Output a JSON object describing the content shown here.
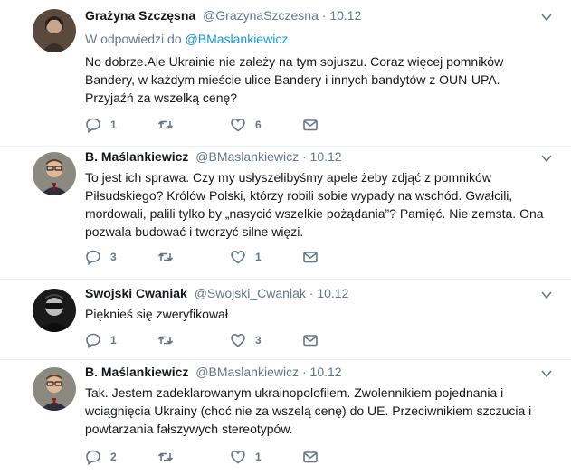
{
  "tweets": [
    {
      "name": "Grażyna Szczęsna",
      "handle": "@GrazynaSzczesna",
      "dot": "·",
      "time": "10.12",
      "reply_prefix": "W odpowiedzi do",
      "reply_mention": "@BMaslankiewicz",
      "text": "No dobrze.Ale Ukrainie nie zależy na tym sojuszu. Coraz więcej pomników Bandery, w każdym mieście ulice Bandery i innych bandytów z OUN-UPA. Przyjaźń za wszelką cenę?",
      "replies": "1",
      "retweets": "",
      "likes": "6"
    },
    {
      "name": "B. Maślankiewicz",
      "handle": "@BMaslankiewicz",
      "dot": "·",
      "time": "10.12",
      "text": "To jest ich sprawa. Czy my usłyszelibyśmy apele żeby zdjąć z pomników Piłsudskiego? Królów Polski, którzy robili sobie wypady na wschód. Gwałcili, mordowali, palili tylko by „nasycić wszelkie pożądania”? Pamięć. Nie zemsta. Ona pozwala budować i tworzyć silne więzi.",
      "replies": "3",
      "retweets": "",
      "likes": "1"
    },
    {
      "name": "Swojski Cwaniak",
      "handle": "@Swojski_Cwaniak",
      "dot": "·",
      "time": "10.12",
      "text": "Pięknieś się zweryfikował",
      "replies": "1",
      "retweets": "",
      "likes": "3"
    },
    {
      "name": "B. Maślankiewicz",
      "handle": "@BMaslankiewicz",
      "dot": "·",
      "time": "10.12",
      "text": "Tak. Jestem zadeklarowanym ukrainopolofilem. Zwolennikiem pojednania i wciągnięcia Ukrainy (choć nie za wszelą cenę) do UE. Przeciwnikiem szczucia i powtarzania fałszywych stereotypów.",
      "replies": "2",
      "retweets": "",
      "likes": "1"
    }
  ],
  "icons": {
    "reply": "reply-icon",
    "retweet": "retweet-icon",
    "like": "heart-icon",
    "dm": "envelope-icon",
    "caret": "chevron-down-icon"
  },
  "colors": {
    "secondary_text": "#657786",
    "link": "#1b95e0",
    "divider": "#e6ecf0"
  }
}
